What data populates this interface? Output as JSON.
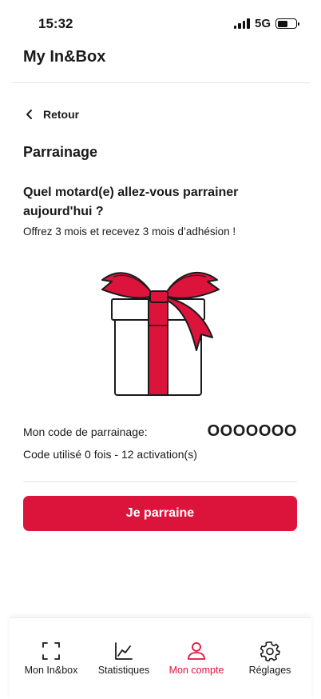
{
  "status_bar": {
    "time": "15:32",
    "network": "5G"
  },
  "header": {
    "title": "My In&Box"
  },
  "nav": {
    "back_label": "Retour"
  },
  "page": {
    "title": "Parrainage",
    "question": "Quel motard(e) allez-vous parrainer aujourd'hui ?",
    "subtext": "Offrez 3 mois et recevez 3 mois d’adhésion !"
  },
  "referral": {
    "code_label": "Mon code de parrainage:",
    "code_value": "OOOOOOO",
    "usage_text": "Code utilisé 0 fois - 12 activation(s)"
  },
  "cta": {
    "label": "Je parraine"
  },
  "tabs": [
    {
      "label": "Mon In&box",
      "icon": "scan-icon",
      "active": false
    },
    {
      "label": "Statistiques",
      "icon": "chart-icon",
      "active": false
    },
    {
      "label": "Mon compte",
      "icon": "user-icon",
      "active": true
    },
    {
      "label": "Réglages",
      "icon": "gear-icon",
      "active": false
    }
  ],
  "colors": {
    "accent": "#dc143c",
    "text": "#1a1a1a",
    "divider": "#e6e6e6"
  }
}
